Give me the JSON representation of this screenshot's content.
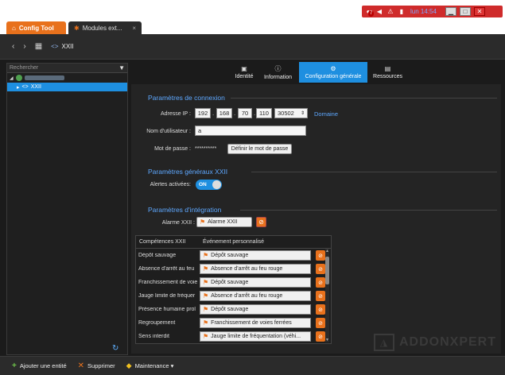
{
  "tray": {
    "badge_count": "7",
    "time": "lun 14:54"
  },
  "tabs": {
    "config_tool": "Config Tool",
    "modules": "Modules ext..."
  },
  "nav": {
    "crumb": "XXII"
  },
  "left": {
    "search_placeholder": "Rechercher",
    "tree_item": "XXII"
  },
  "section_tabs": {
    "identite": "Identité",
    "information": "Information",
    "config": "Configuration générale",
    "ressources": "Ressources"
  },
  "connexion": {
    "title": "Paramètres de connexion",
    "ip_label": "Adresse IP :",
    "ip": [
      "192",
      "168",
      "70",
      "110"
    ],
    "port": "30502",
    "domain_link": "Domaine",
    "user_label": "Nom d'utilisateur :",
    "user_value": "a",
    "password_label": "Mot de passe :",
    "password_mask": "**********",
    "set_password": "Définir le mot de passe"
  },
  "general": {
    "title": "Paramètres généraux XXII",
    "alerts_label": "Alertes activées:",
    "toggle": "ON"
  },
  "integration": {
    "title": "Paramètres d'intégration",
    "alarm_label": "Alarme XXII :",
    "alarm_value": "Alarme XXII"
  },
  "table": {
    "col1": "Compétences XXII",
    "col2": "Événement personnalisé",
    "rows": [
      {
        "name": "Dépôt sauvage",
        "event": "Dépôt sauvage"
      },
      {
        "name": "Absence d'arrêt au feu",
        "event": "Absence d'arrêt au feu rouge"
      },
      {
        "name": "Franchissement de voie",
        "event": "Dépôt sauvage"
      },
      {
        "name": "Jauge limite de fréquer",
        "event": "Absence d'arrêt au feu rouge"
      },
      {
        "name": "Présence humaine prol",
        "event": "Dépôt sauvage"
      },
      {
        "name": "Regroupement",
        "event": "Franchissement de voies ferrées"
      },
      {
        "name": "Sens interdit",
        "event": "Jauge limite de fréquentation (véhi..."
      }
    ]
  },
  "watermark": "ADDONXPERT",
  "bottom": {
    "add": "Ajouter une entité",
    "delete": "Supprimer",
    "maintenance": "Maintenance ▾"
  }
}
